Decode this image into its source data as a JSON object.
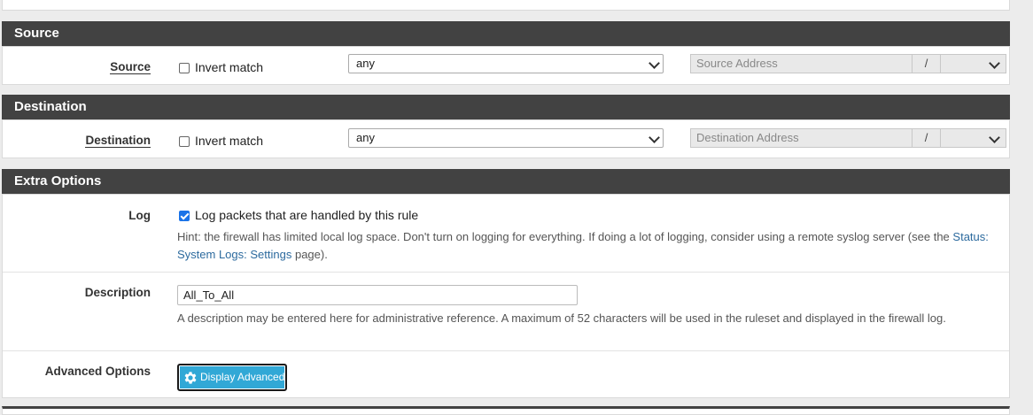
{
  "source": {
    "header": "Source",
    "label": "Source",
    "invert_label": "Invert match",
    "invert_checked": false,
    "type_value": "any",
    "address_placeholder": "Source Address",
    "slash": "/"
  },
  "destination": {
    "header": "Destination",
    "label": "Destination",
    "invert_label": "Invert match",
    "invert_checked": false,
    "type_value": "any",
    "address_placeholder": "Destination Address",
    "slash": "/"
  },
  "extra": {
    "header": "Extra Options",
    "log": {
      "label": "Log",
      "checkbox_label": "Log packets that are handled by this rule",
      "checked": true,
      "hint_text": "Hint: the firewall has limited local log space. Don't turn on logging for everything. If doing a lot of logging, consider using a remote syslog server (see the",
      "hint_link": "Status: System Logs: Settings",
      "hint_tail": "page)."
    },
    "description": {
      "label": "Description",
      "value": "All_To_All",
      "hint": "A description may be entered here for administrative reference. A maximum of 52 characters will be used in the ruleset and displayed in the firewall log."
    },
    "advanced": {
      "label": "Advanced Options",
      "button_label": "Display Advanced",
      "button_icon": "gear-icon"
    }
  },
  "colors": {
    "panel_header": "#424242",
    "button": "#31a8d6",
    "link": "#2c6a9e",
    "checkbox_checked": "#1a73e8"
  }
}
